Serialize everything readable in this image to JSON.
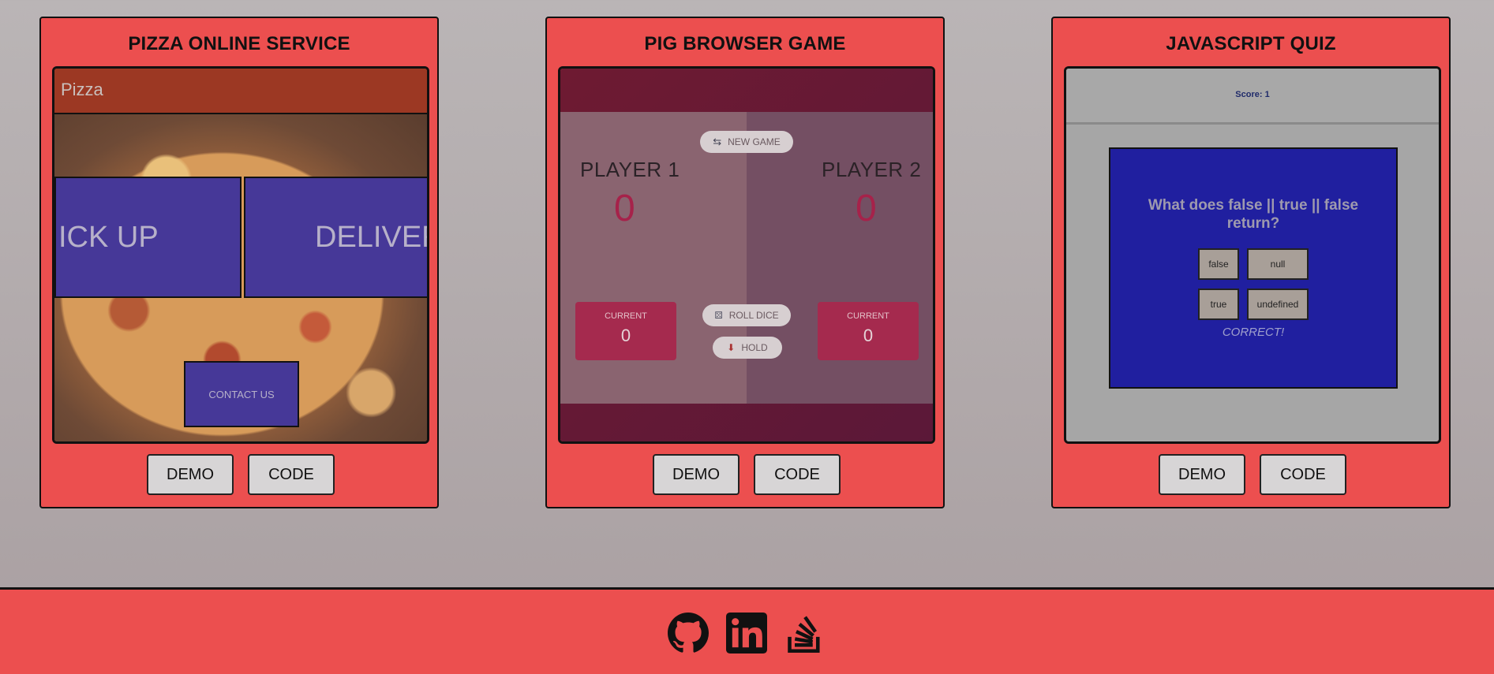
{
  "projects": [
    {
      "title": "PIZZA ONLINE SERVICE",
      "demo_label": "DEMO",
      "code_label": "CODE",
      "preview": {
        "brand": "Pizza",
        "pick_up_label": "ICK UP",
        "delivery_label": "DELIVER",
        "contact_label": "CONTACT US"
      }
    },
    {
      "title": "PIG BROWSER GAME",
      "demo_label": "DEMO",
      "code_label": "CODE",
      "preview": {
        "new_game_label": "NEW GAME",
        "player1_name": "PLAYER 1",
        "player2_name": "PLAYER 2",
        "player1_score": "0",
        "player2_score": "0",
        "current_label": "CURRENT",
        "player1_current": "0",
        "player2_current": "0",
        "roll_dice_label": "ROLL DICE",
        "hold_label": "HOLD"
      }
    },
    {
      "title": "JAVASCRIPT QUIZ",
      "demo_label": "DEMO",
      "code_label": "CODE",
      "preview": {
        "score_text": "Score: 1",
        "question": "What does false || true || false return?",
        "options": [
          "false",
          "null",
          "true",
          "undefined"
        ],
        "result": "CORRECT!"
      }
    }
  ],
  "footer": {
    "icons": [
      "github-icon",
      "linkedin-icon",
      "stackoverflow-icon"
    ]
  },
  "colors": {
    "card_bg": "#ec4f4f",
    "page_bg": "#bab5b6",
    "button_bg": "#d7d5d6",
    "quiz_box": "#201f9f"
  }
}
